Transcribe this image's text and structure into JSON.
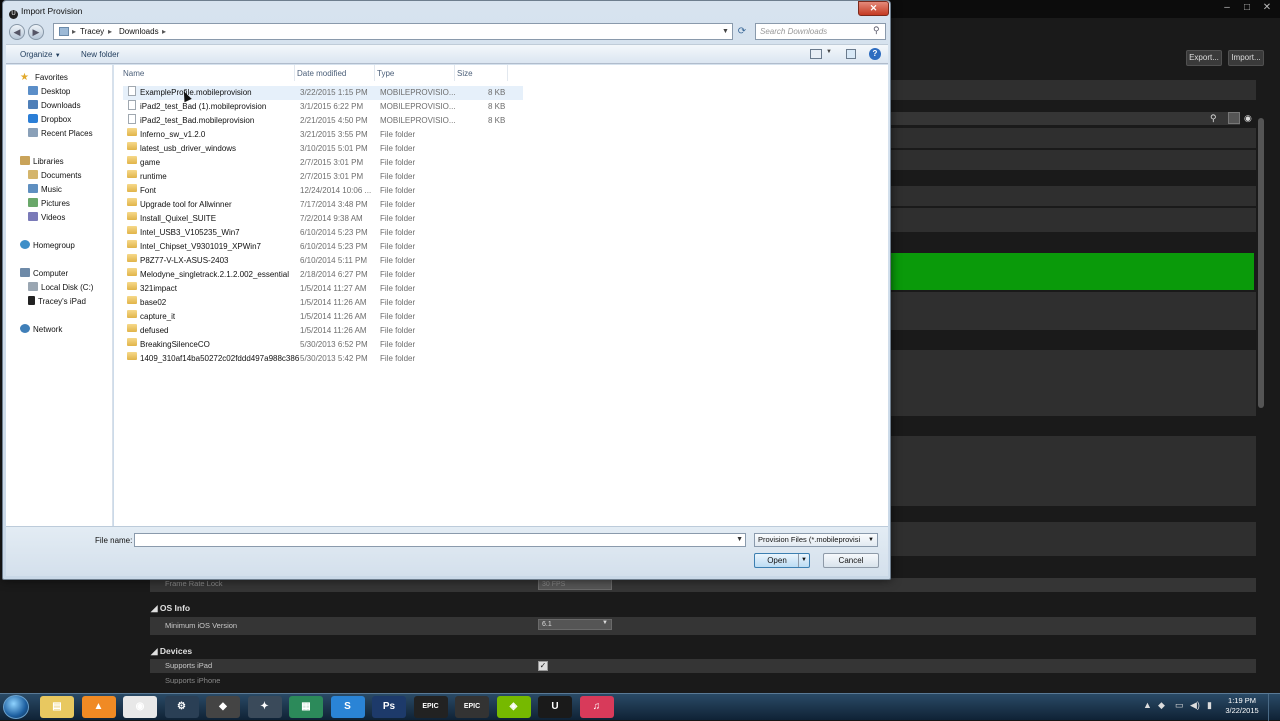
{
  "dialog": {
    "title": "Import Provision",
    "close_glyph": "✕",
    "address": {
      "crumbs": [
        "Tracey",
        "Downloads"
      ]
    },
    "search_placeholder": "Search Downloads",
    "toolbar": {
      "organize": "Organize",
      "new_folder": "New folder"
    },
    "columns": {
      "name": "Name",
      "date": "Date modified",
      "type": "Type",
      "size": "Size"
    },
    "nav": {
      "favorites": {
        "label": "Favorites",
        "items": [
          "Desktop",
          "Downloads",
          "Dropbox",
          "Recent Places"
        ]
      },
      "libraries": {
        "label": "Libraries",
        "items": [
          "Documents",
          "Music",
          "Pictures",
          "Videos"
        ]
      },
      "homegroup": "Homegroup",
      "computer": {
        "label": "Computer",
        "items": [
          "Local Disk (C:)",
          "Tracey's iPad"
        ]
      },
      "network": "Network"
    },
    "files": [
      {
        "name": "ExampleProfile.mobileprovision",
        "date": "3/22/2015 1:15 PM",
        "type": "MOBILEPROVISIO...",
        "size": "8 KB",
        "kind": "file"
      },
      {
        "name": "iPad2_test_Bad (1).mobileprovision",
        "date": "3/1/2015 6:22 PM",
        "type": "MOBILEPROVISIO...",
        "size": "8 KB",
        "kind": "file"
      },
      {
        "name": "iPad2_test_Bad.mobileprovision",
        "date": "2/21/2015 4:50 PM",
        "type": "MOBILEPROVISIO...",
        "size": "8 KB",
        "kind": "file"
      },
      {
        "name": "Inferno_sw_v1.2.0",
        "date": "3/21/2015 3:55 PM",
        "type": "File folder",
        "size": "",
        "kind": "folder"
      },
      {
        "name": "latest_usb_driver_windows",
        "date": "3/10/2015 5:01 PM",
        "type": "File folder",
        "size": "",
        "kind": "folder"
      },
      {
        "name": "game",
        "date": "2/7/2015 3:01 PM",
        "type": "File folder",
        "size": "",
        "kind": "folder"
      },
      {
        "name": "runtime",
        "date": "2/7/2015 3:01 PM",
        "type": "File folder",
        "size": "",
        "kind": "folder"
      },
      {
        "name": "Font",
        "date": "12/24/2014 10:06 ...",
        "type": "File folder",
        "size": "",
        "kind": "folder"
      },
      {
        "name": "Upgrade tool for Allwinner",
        "date": "7/17/2014 3:48 PM",
        "type": "File folder",
        "size": "",
        "kind": "folder"
      },
      {
        "name": "Install_Quixel_SUITE",
        "date": "7/2/2014 9:38 AM",
        "type": "File folder",
        "size": "",
        "kind": "folder"
      },
      {
        "name": "Intel_USB3_V105235_Win7",
        "date": "6/10/2014 5:23 PM",
        "type": "File folder",
        "size": "",
        "kind": "folder"
      },
      {
        "name": "Intel_Chipset_V9301019_XPWin7",
        "date": "6/10/2014 5:23 PM",
        "type": "File folder",
        "size": "",
        "kind": "folder"
      },
      {
        "name": "P8Z77-V-LX-ASUS-2403",
        "date": "6/10/2014 5:11 PM",
        "type": "File folder",
        "size": "",
        "kind": "folder"
      },
      {
        "name": "Melodyne_singletrack.2.1.2.002_essential",
        "date": "2/18/2014 6:27 PM",
        "type": "File folder",
        "size": "",
        "kind": "folder"
      },
      {
        "name": "321impact",
        "date": "1/5/2014 11:27 AM",
        "type": "File folder",
        "size": "",
        "kind": "folder"
      },
      {
        "name": "base02",
        "date": "1/5/2014 11:26 AM",
        "type": "File folder",
        "size": "",
        "kind": "folder"
      },
      {
        "name": "capture_it",
        "date": "1/5/2014 11:26 AM",
        "type": "File folder",
        "size": "",
        "kind": "folder"
      },
      {
        "name": "defused",
        "date": "1/5/2014 11:26 AM",
        "type": "File folder",
        "size": "",
        "kind": "folder"
      },
      {
        "name": "BreakingSilenceCO",
        "date": "5/30/2013 6:52 PM",
        "type": "File folder",
        "size": "",
        "kind": "folder"
      },
      {
        "name": "1409_310af14ba50272c02fddd497a988c386",
        "date": "5/30/2013 5:42 PM",
        "type": "File folder",
        "size": "",
        "kind": "folder"
      }
    ],
    "filename_label": "File name:",
    "filename_value": "",
    "filter": "Provision Files (*.mobileprovisi",
    "open": "Open",
    "cancel": "Cancel"
  },
  "background": {
    "export": "Export...",
    "import": "Import...",
    "frame_rate_label": "Frame Rate Lock",
    "frame_rate_value": "30 FPS",
    "os_info": "OS Info",
    "min_os_label": "Minimum iOS Version",
    "min_os_value": "6.1",
    "devices": "Devices",
    "supports_ipad": "Supports iPad",
    "supports_iphone": "Supports iPhone",
    "accent_green": "#0a9a0a"
  },
  "taskbar": {
    "apps": [
      "Explorer",
      "VLC",
      "Chrome",
      "Steam",
      "Unity",
      "Unreal",
      "Maps",
      "Skype",
      "Photoshop",
      "EPIC",
      "EPIC",
      "NVIDIA",
      "UE4",
      "iTunes"
    ],
    "time": "1:19 PM",
    "date": "3/22/2015"
  }
}
